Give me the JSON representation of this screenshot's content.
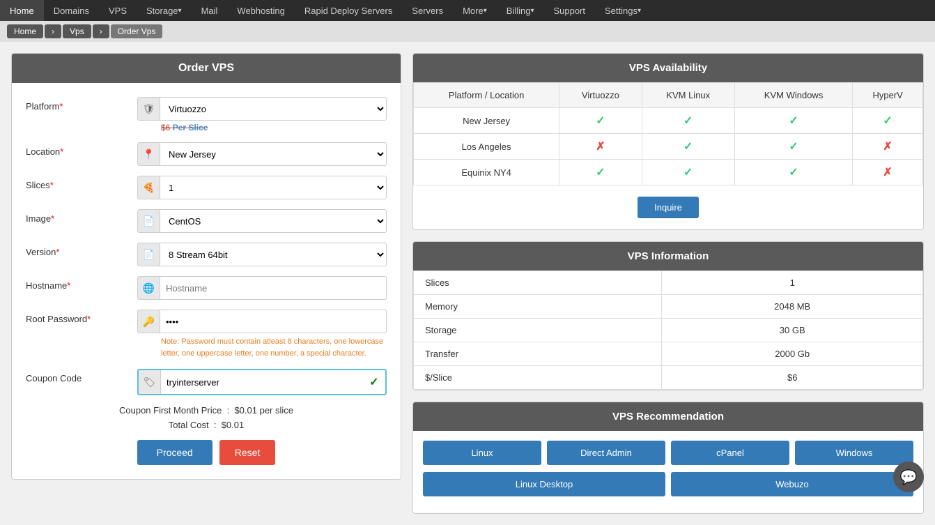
{
  "nav": {
    "items": [
      {
        "label": "Home",
        "arrow": false
      },
      {
        "label": "Domains",
        "arrow": false
      },
      {
        "label": "VPS",
        "arrow": false
      },
      {
        "label": "Storage",
        "arrow": true
      },
      {
        "label": "Mail",
        "arrow": false
      },
      {
        "label": "Webhosting",
        "arrow": false
      },
      {
        "label": "Rapid Deploy Servers",
        "arrow": false
      },
      {
        "label": "Servers",
        "arrow": false
      },
      {
        "label": "More",
        "arrow": true
      },
      {
        "label": "Billing",
        "arrow": true
      },
      {
        "label": "Support",
        "arrow": false
      },
      {
        "label": "Settings",
        "arrow": true
      }
    ]
  },
  "breadcrumb": {
    "items": [
      "Home",
      "Vps",
      "Order Vps"
    ]
  },
  "order_form": {
    "title": "Order VPS",
    "platform_label": "Platform",
    "platform_value": "Virtuozzo",
    "price_strike": "$6",
    "per_slice": "Per Slice",
    "location_label": "Location",
    "location_value": "New Jersey",
    "slices_label": "Slices",
    "slices_value": "1",
    "image_label": "Image",
    "image_value": "CentOS",
    "version_label": "Version",
    "version_value": "8 Stream 64bit",
    "hostname_label": "Hostname",
    "hostname_placeholder": "Hostname",
    "root_password_label": "Root Password",
    "root_password_value": "0000",
    "password_note": "Note: Password must contain atleast 8 characters, one lowercase letter, one uppercase letter, one number, a special character.",
    "coupon_code_label": "Coupon Code",
    "coupon_value": "tryinterserver",
    "coupon_first_month_label": "Coupon First Month Price",
    "coupon_first_month_value": "$0.01 per slice",
    "total_cost_label": "Total Cost",
    "total_cost_value": "$0.01",
    "proceed_label": "Proceed",
    "reset_label": "Reset"
  },
  "availability": {
    "title": "VPS Availability",
    "columns": [
      "Platform / Location",
      "Virtuozzo",
      "KVM Linux",
      "KVM Windows",
      "HyperV"
    ],
    "rows": [
      {
        "location": "New Jersey",
        "virtuozzo": true,
        "kvm_linux": true,
        "kvm_windows": true,
        "hyperv": true
      },
      {
        "location": "Los Angeles",
        "virtuozzo": false,
        "kvm_linux": true,
        "kvm_windows": true,
        "hyperv": false
      },
      {
        "location": "Equinix NY4",
        "virtuozzo": true,
        "kvm_linux": true,
        "kvm_windows": true,
        "hyperv": false
      }
    ],
    "inquire_label": "Inquire"
  },
  "vps_info": {
    "title": "VPS Information",
    "rows": [
      {
        "label": "Slices",
        "value": "1"
      },
      {
        "label": "Memory",
        "value": "2048 MB"
      },
      {
        "label": "Storage",
        "value": "30 GB"
      },
      {
        "label": "Transfer",
        "value": "2000 Gb"
      },
      {
        "label": "$/Slice",
        "value": "$6"
      }
    ]
  },
  "recommendation": {
    "title": "VPS Recommendation",
    "row1": [
      "Linux",
      "Direct Admin",
      "cPanel",
      "Windows"
    ],
    "row2": [
      "Linux Desktop",
      "Webuzo"
    ]
  }
}
